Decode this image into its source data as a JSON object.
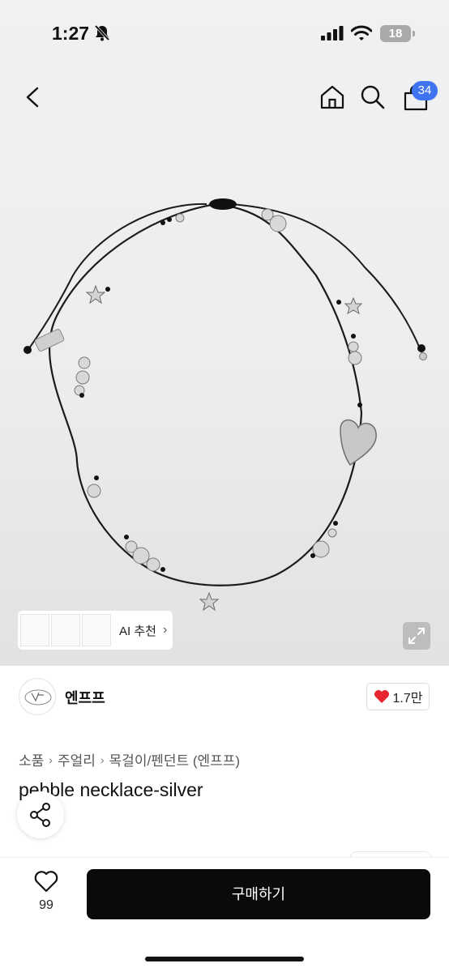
{
  "status_bar": {
    "time": "1:27",
    "battery": "18"
  },
  "nav": {
    "cart_count": "34"
  },
  "image_overlay": {
    "ai_label": "AI 추천",
    "ai_chevron": "›"
  },
  "seller": {
    "name": "엔프프",
    "likes": "1.7만"
  },
  "breadcrumb": [
    {
      "label": "소품"
    },
    {
      "label": "주얼리"
    },
    {
      "label": "목걸이/펜던트 (엔프프)"
    }
  ],
  "breadcrumb_sep": "›",
  "product": {
    "title": "pebble necklace-silver"
  },
  "bottom_bar": {
    "wish_count": "99",
    "buy_label": "구매하기"
  },
  "icons": [
    "bell-slash-icon",
    "signal-icon",
    "wifi-icon",
    "battery-icon",
    "back-arrow-icon",
    "home-icon",
    "search-icon",
    "cart-icon",
    "expand-icon",
    "heart-icon",
    "share-icon",
    "heart-outline-icon"
  ],
  "colors": {
    "accent_badge": "#3f74f0",
    "buy_button": "#0a0a0a",
    "like_heart": "#e8242f"
  }
}
